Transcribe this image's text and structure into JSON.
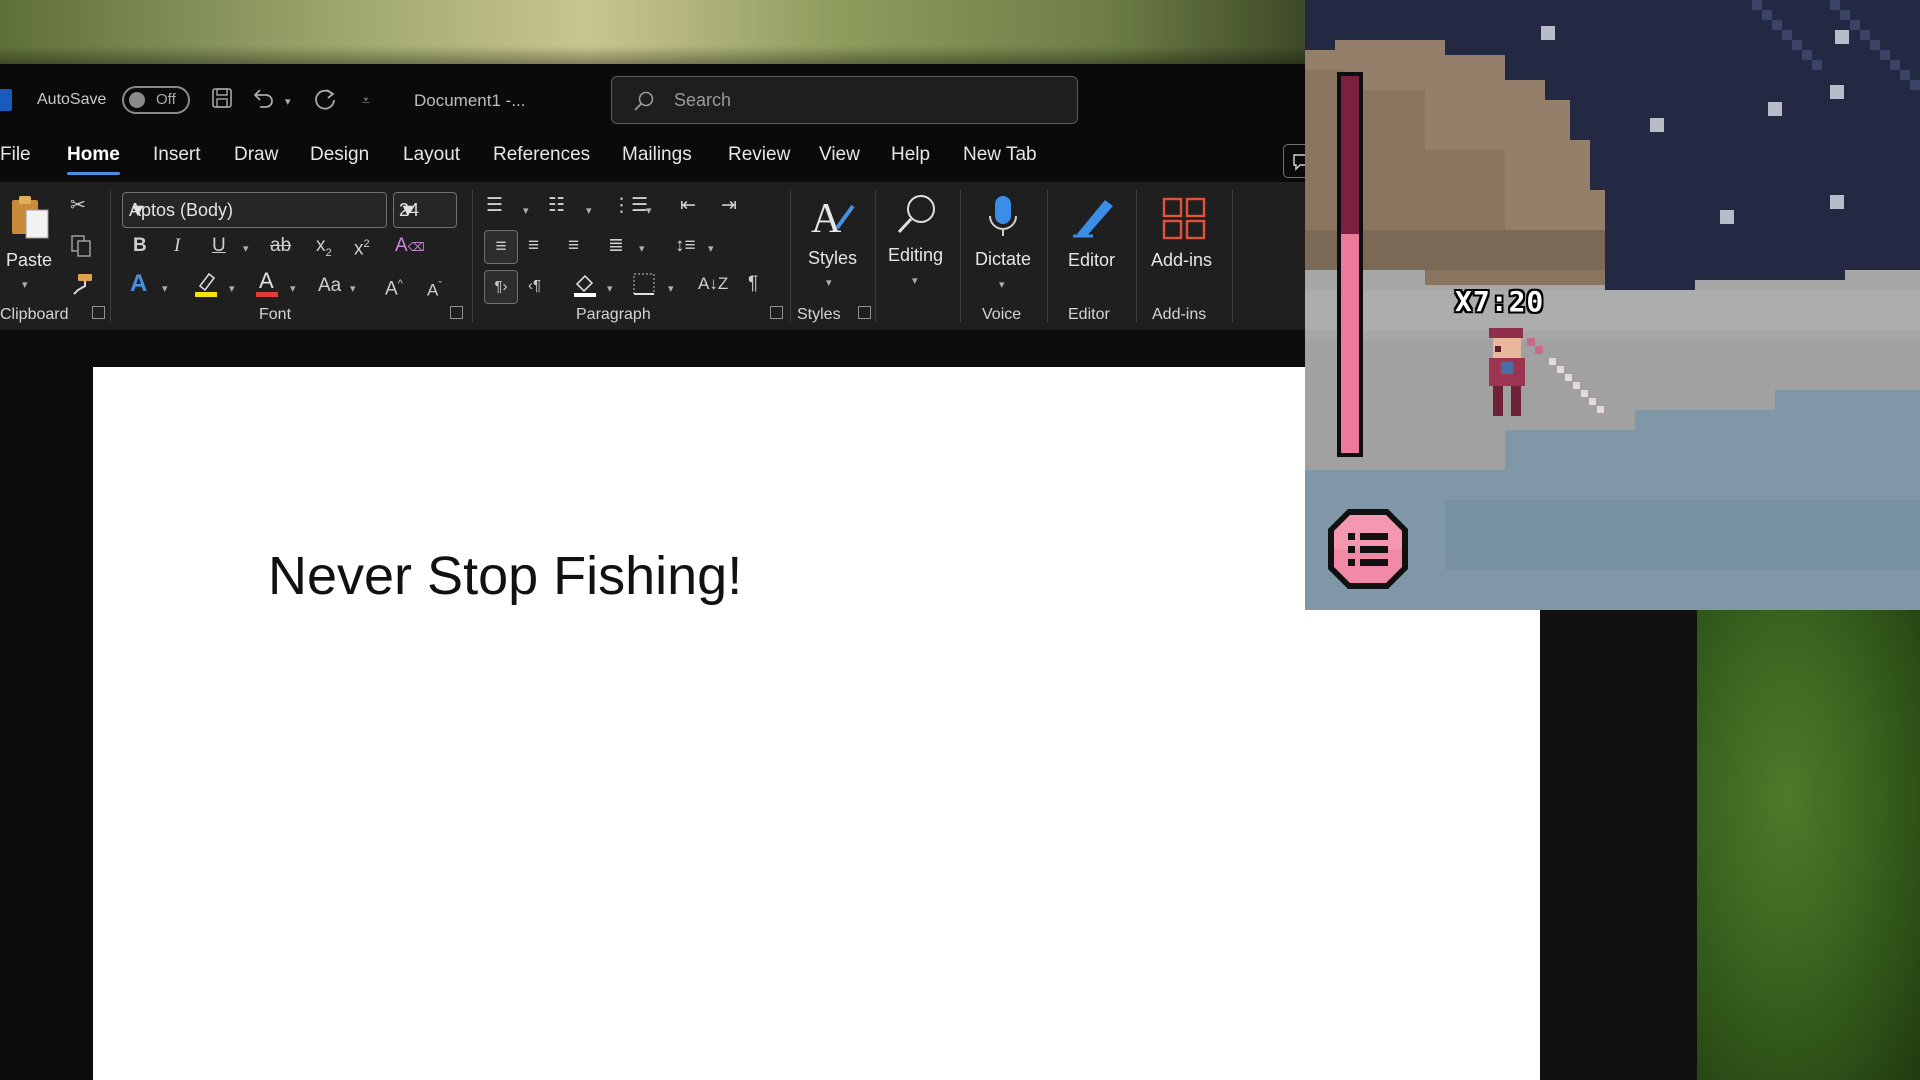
{
  "titlebar": {
    "autosave_label": "AutoSave",
    "autosave_state": "Off",
    "document_title": "Document1  -...",
    "search_placeholder": "Search"
  },
  "menu": {
    "items": [
      "File",
      "Home",
      "Insert",
      "Draw",
      "Design",
      "Layout",
      "References",
      "Mailings",
      "Review",
      "View",
      "Help",
      "New Tab"
    ],
    "active": "Home"
  },
  "ribbon": {
    "clipboard": {
      "label": "Clipboard",
      "paste": "Paste"
    },
    "font": {
      "label": "Font",
      "family": "Aptos (Body)",
      "size": "24"
    },
    "paragraph": {
      "label": "Paragraph"
    },
    "styles": {
      "label": "Styles",
      "button": "Styles"
    },
    "editing": {
      "button": "Editing"
    },
    "voice": {
      "label": "Voice",
      "button": "Dictate"
    },
    "editor": {
      "label": "Editor",
      "button": "Editor"
    },
    "addins": {
      "label": "Add-ins",
      "button": "Add-ins"
    }
  },
  "document": {
    "text": "Never Stop Fishing!"
  },
  "game": {
    "timer": "X7:20",
    "tension_level": 0.58,
    "colors": {
      "sky": "#242943",
      "cliff": "#8a7560",
      "stone": "#a7a7a7",
      "water": "#7f97a7",
      "bar_fill": "#ec7a9b",
      "bar_empty": "#7a2040",
      "button": "#f18aa6"
    },
    "icons": {
      "menu_button": "list-icon",
      "player": "fisher-sprite"
    }
  }
}
